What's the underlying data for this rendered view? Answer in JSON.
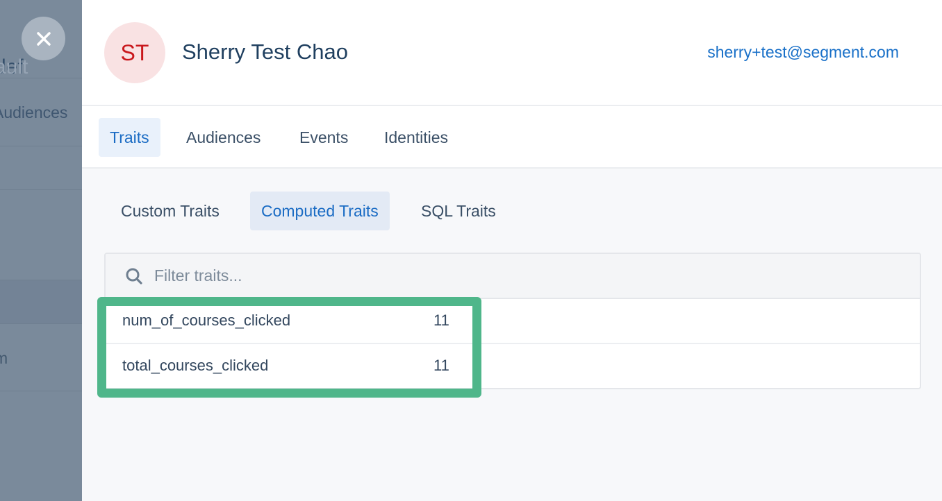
{
  "backdrop": {
    "title_visible": "def",
    "title_faded": "ault",
    "row_audiences": "Audiences",
    "row_partial": "m"
  },
  "close_button": {
    "icon": "close-icon"
  },
  "profile": {
    "initials": "ST",
    "name": "Sherry Test Chao",
    "email": "sherry+test@segment.com"
  },
  "tabs": [
    {
      "label": "Traits",
      "active": true
    },
    {
      "label": "Audiences",
      "active": false
    },
    {
      "label": "Events",
      "active": false
    },
    {
      "label": "Identities",
      "active": false
    }
  ],
  "subtabs": [
    {
      "label": "Custom Traits",
      "active": false
    },
    {
      "label": "Computed Traits",
      "active": true
    },
    {
      "label": "SQL Traits",
      "active": false
    }
  ],
  "filter": {
    "placeholder": "Filter traits...",
    "value": "",
    "icon": "search-icon"
  },
  "traits": [
    {
      "name": "num_of_courses_clicked",
      "value": "11"
    },
    {
      "name": "total_courses_clicked",
      "value": "11"
    }
  ],
  "colors": {
    "accent": "#1b6cc4",
    "highlight": "#4fb68a",
    "avatar_bg": "#f9e2e3",
    "avatar_text": "#c9171c"
  }
}
